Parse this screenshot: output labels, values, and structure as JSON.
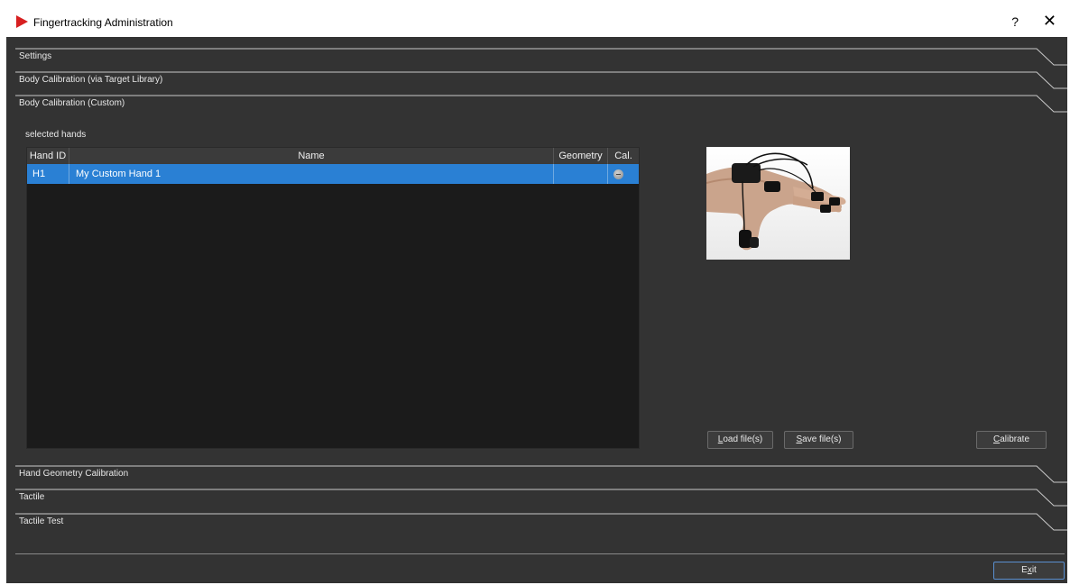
{
  "window": {
    "title": "Fingertracking Administration",
    "help_glyph": "?",
    "close_glyph": "✕"
  },
  "sections": {
    "settings": "Settings",
    "body_calib_target": "Body Calibration (via Target Library)",
    "body_calib_custom": "Body Calibration (Custom)",
    "hand_geometry": "Hand Geometry Calibration",
    "tactile": "Tactile",
    "tactile_test": "Tactile Test"
  },
  "hands": {
    "label": "selected hands",
    "columns": [
      "Hand ID",
      "Name",
      "Geometry",
      "Cal."
    ],
    "rows": [
      {
        "id": "H1",
        "name": "My Custom Hand 1",
        "geometry": "",
        "cal_icon": "status-dot-icon"
      }
    ]
  },
  "buttons": {
    "load": {
      "prefix": "",
      "mnemonic": "L",
      "rest": "oad file(s)"
    },
    "save": {
      "prefix": "",
      "mnemonic": "S",
      "rest": "ave file(s)"
    },
    "calibrate": {
      "prefix": "",
      "mnemonic": "C",
      "rest": "alibrate"
    },
    "exit": {
      "prefix": "E",
      "mnemonic": "x",
      "rest": "it"
    }
  },
  "colors": {
    "background": "#333333",
    "selection": "#2a80d4",
    "brand": "#d71f20"
  }
}
